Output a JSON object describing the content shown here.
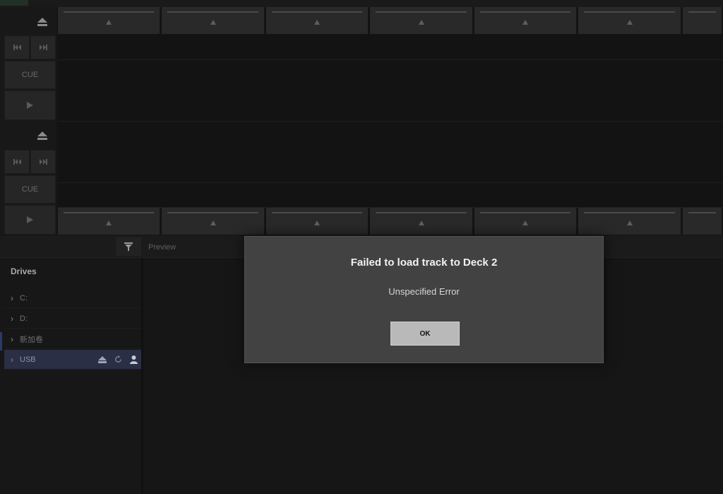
{
  "deck1": {
    "cue_label": "CUE",
    "eject_icon": "eject-icon",
    "prev_icon": "skip-back-icon",
    "next_icon": "skip-forward-icon",
    "play_icon": "play-icon"
  },
  "deck2": {
    "cue_label": "CUE",
    "eject_icon": "eject-icon",
    "prev_icon": "skip-back-icon",
    "next_icon": "skip-forward-icon",
    "play_icon": "play-icon"
  },
  "library": {
    "filter_icon": "filter-icon",
    "preview_label": "Preview",
    "drives_header": "Drives",
    "drives": [
      {
        "label": "C:"
      },
      {
        "label": "D:"
      },
      {
        "label": "新加卷"
      },
      {
        "label": "USB",
        "selected": true
      }
    ],
    "usb_actions": [
      "eject-icon",
      "refresh-icon",
      "user-icon"
    ]
  },
  "dialog": {
    "title": "Failed to load track to Deck 2",
    "message": "Unspecified Error",
    "ok_label": "OK"
  },
  "colors": {
    "background": "#141414",
    "dialog_bg": "#424242",
    "selected_drive_bg": "#2b2f45",
    "ok_button_bg": "#b9b9b9"
  }
}
